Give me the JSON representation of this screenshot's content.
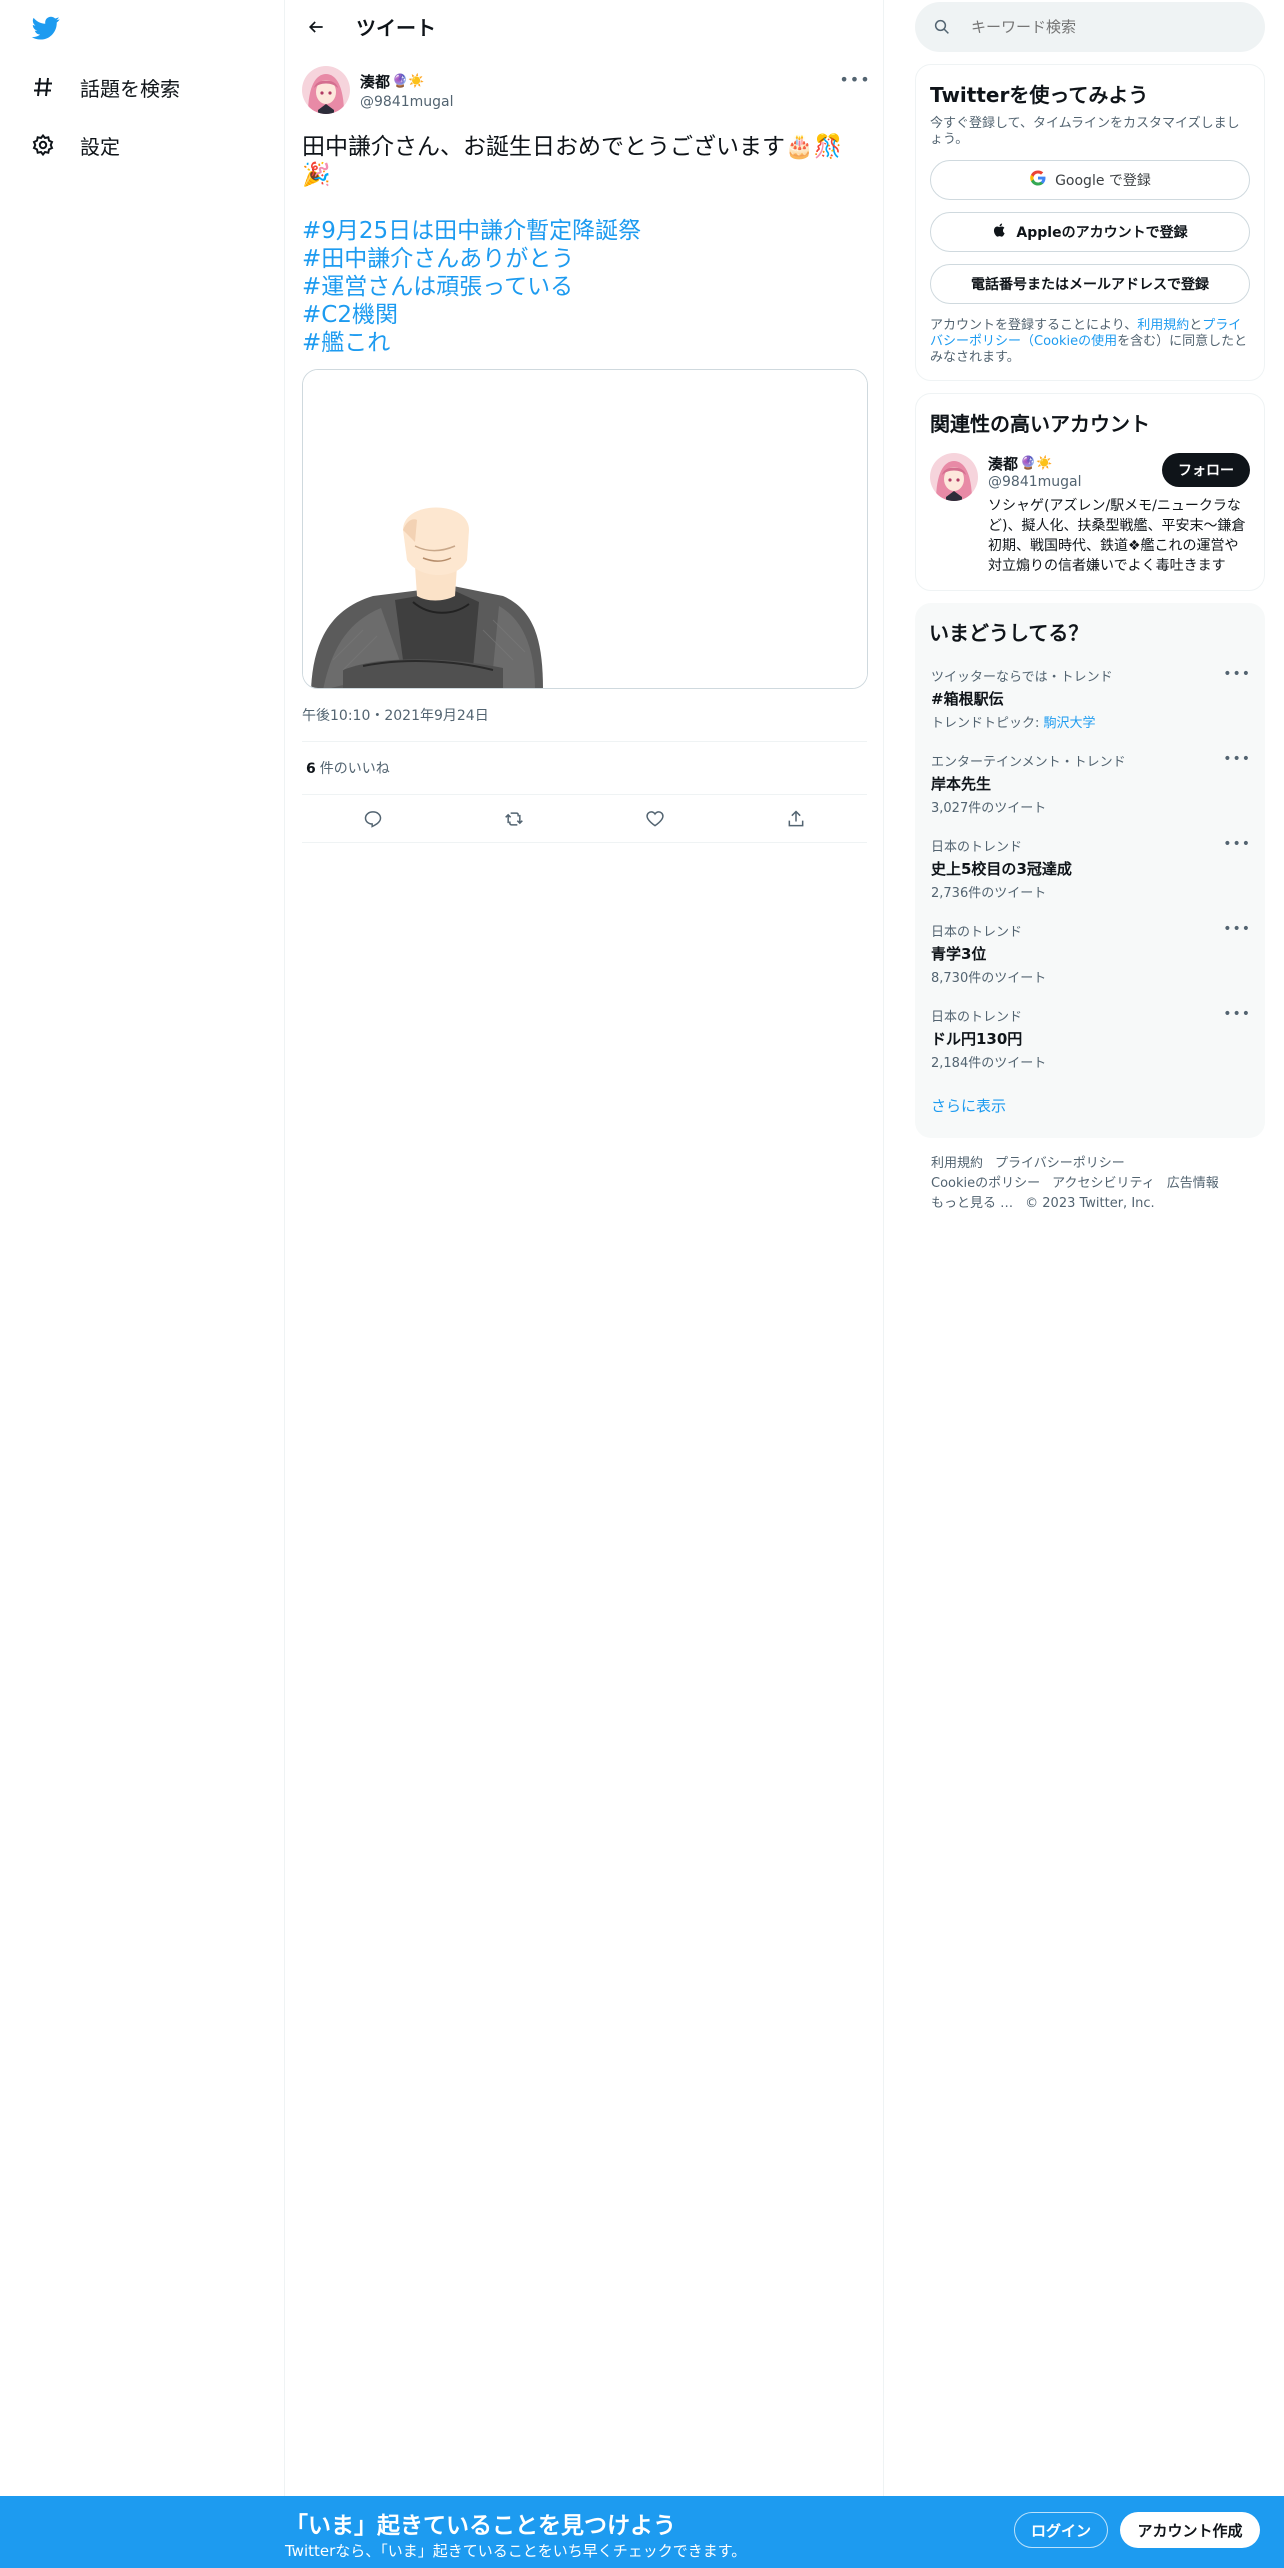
{
  "nav": {
    "logo_icon": "twitter-bird-icon",
    "explore_label": "話題を検索",
    "settings_label": "設定"
  },
  "header": {
    "title": "ツイート"
  },
  "tweet": {
    "author_name": "湊都",
    "author_badges": "🔮☀️",
    "author_handle": "@9841mugal",
    "text_line1": "田中謙介さん、お誕生日おめでとうございます🎂🎊🎉",
    "hashtags": [
      "#9月25日は田中謙介暫定降誕祭",
      "#田中謙介さんありがとう",
      "#運営さんは頑張っている",
      "#C2機関",
      "#艦これ"
    ],
    "timestamp": "午後10:10・2021年9月24日",
    "likes_count": "6",
    "likes_label": "件のいいね"
  },
  "search": {
    "placeholder": "キーワード検索"
  },
  "signup": {
    "title": "Twitterを使ってみよう",
    "subtitle": "今すぐ登録して、タイムラインをカスタマイズしましょう。",
    "google_btn": "Google で登録",
    "apple_btn": "Appleのアカウントで登録",
    "phone_btn": "電話番号またはメールアドレスで登録",
    "legal_pre": "アカウントを登録することにより、",
    "legal_terms": "利用規約",
    "legal_and": "と",
    "legal_privacy": "プライバシーポリシー（Cookieの使用",
    "legal_post": "を含む）に同意したとみなされます。"
  },
  "related": {
    "title": "関連性の高いアカウント",
    "name": "湊都",
    "badges": "🔮☀️",
    "handle": "@9841mugal",
    "follow_label": "フォロー",
    "bio": "ソシャゲ(アズレン/駅メモ/ニュークラなど)、擬人化、扶桑型戦艦、平安末～鎌倉初期、戦国時代、鉄道❖艦これの運営や対立煽りの信者嫌いでよく毒吐きます"
  },
  "trends": {
    "title": "いまどうしてる？",
    "items": [
      {
        "meta": "ツイッターならでは・トレンド",
        "name": "#箱根駅伝",
        "count_pre": "トレンドトピック: ",
        "count_link": "駒沢大学"
      },
      {
        "meta": "エンターテインメント・トレンド",
        "name": "岸本先生",
        "count": "3,027件のツイート"
      },
      {
        "meta": "日本のトレンド",
        "name": "史上5校目の3冠達成",
        "count": "2,736件のツイート"
      },
      {
        "meta": "日本のトレンド",
        "name": "青学3位",
        "count": "8,730件のツイート"
      },
      {
        "meta": "日本のトレンド",
        "name": "ドル円130円",
        "count": "2,184件のツイート"
      }
    ],
    "show_more": "さらに表示"
  },
  "footer": {
    "links_row1": [
      "利用規約",
      "プライバシーポリシー"
    ],
    "links_row2": [
      "Cookieのポリシー",
      "アクセシビリティ",
      "広告情報"
    ],
    "more": "もっと見る …",
    "copyright": "© 2023 Twitter, Inc."
  },
  "bottom_bar": {
    "title": "「いま」起きていることを見つけよう",
    "subtitle": "Twitterなら、「いま」起きていることをいち早くチェックできます。",
    "login_label": "ログイン",
    "signup_label": "アカウント作成"
  },
  "colors": {
    "accent": "#1d9bf0",
    "text": "#0f1419",
    "muted": "#536471"
  }
}
